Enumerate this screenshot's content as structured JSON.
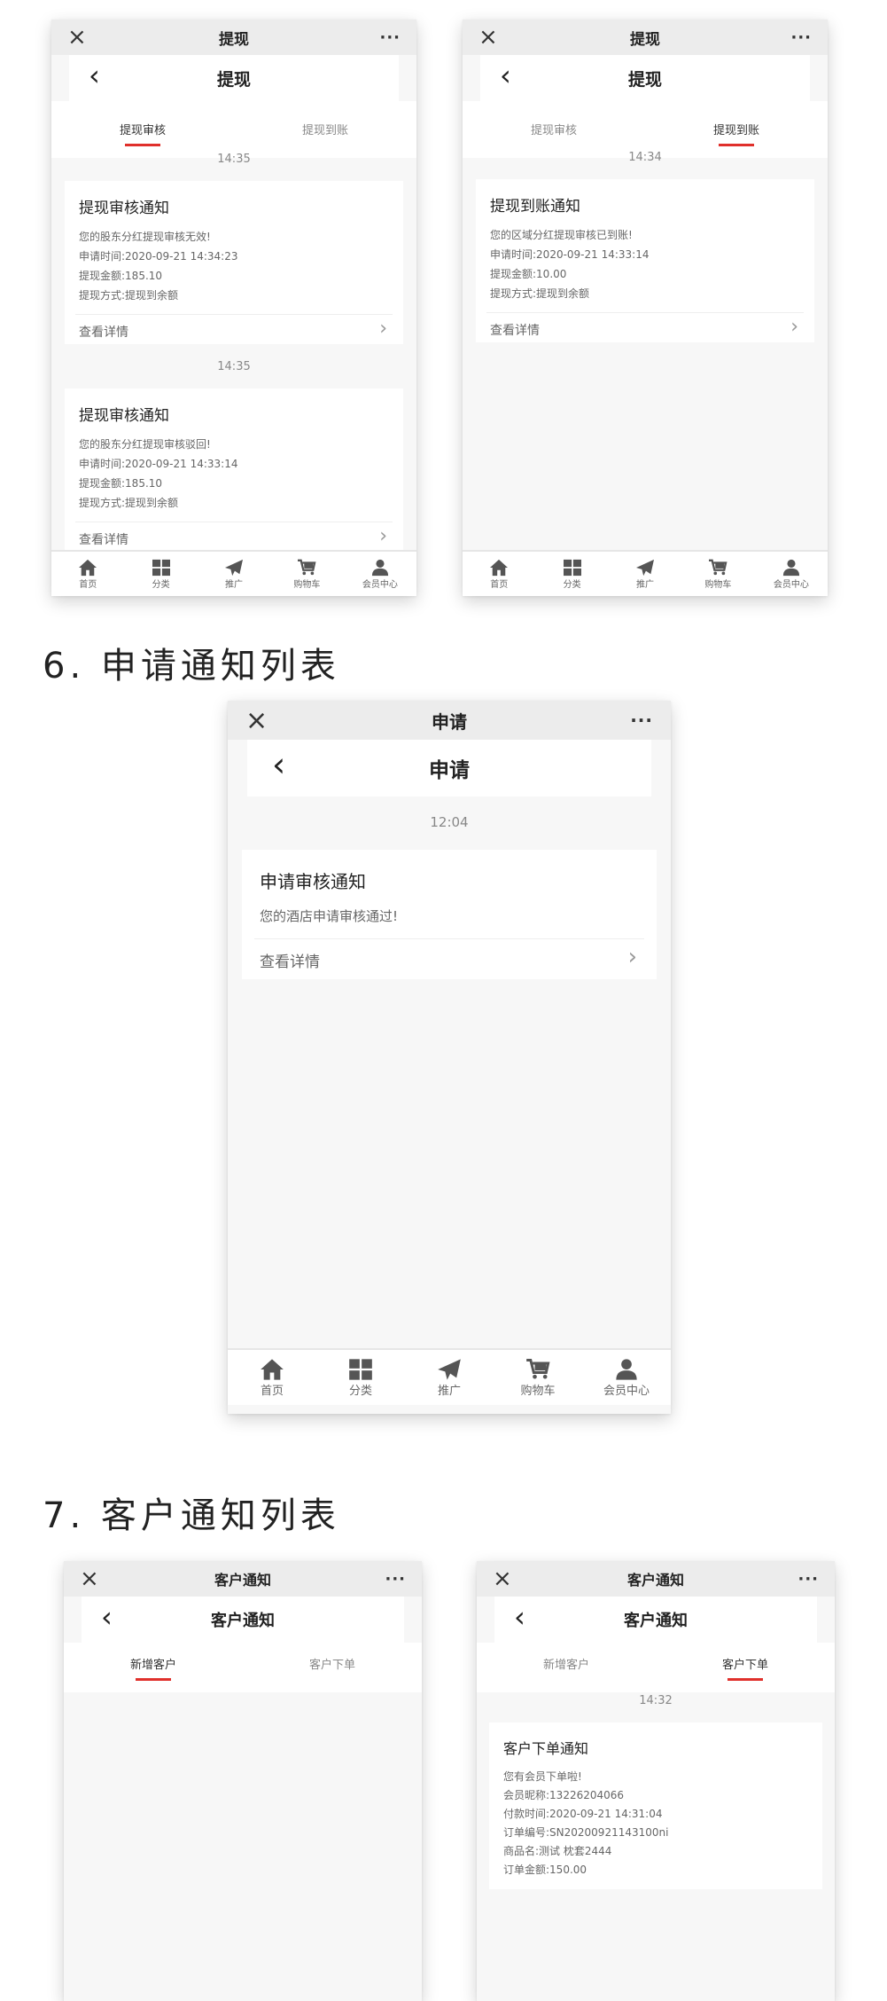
{
  "sections": {
    "s6": "6. 申请通知列表",
    "s7": "7. 客户通知列表"
  },
  "common": {
    "close_icon": "×",
    "more_icon": "···",
    "back_icon": "‹",
    "detail": "查看详情",
    "arrow": "›"
  },
  "nav": {
    "items": [
      {
        "icon": "home-icon",
        "label": "首页"
      },
      {
        "icon": "grid-icon",
        "label": "分类"
      },
      {
        "icon": "paper-plane-icon",
        "label": "推广"
      },
      {
        "icon": "cart-icon",
        "label": "购物车"
      },
      {
        "icon": "user-icon",
        "label": "会员中心"
      }
    ]
  },
  "withdraw_review": {
    "title": "提现",
    "tabs": [
      "提现审核",
      "提现到账"
    ],
    "active_tab": 0,
    "notices": [
      {
        "time": "14:35",
        "title": "提现审核通知",
        "lines": [
          "您的股东分红提现审核无效!",
          "申请时间:2020-09-21 14:34:23",
          "提现金额:185.10",
          "提现方式:提现到余额"
        ]
      },
      {
        "time": "14:35",
        "title": "提现审核通知",
        "lines": [
          "您的股东分红提现审核驳回!",
          "申请时间:2020-09-21 14:33:14",
          "提现金额:185.10",
          "提现方式:提现到余额"
        ]
      }
    ]
  },
  "withdraw_arrival": {
    "title": "提现",
    "tabs": [
      "提现审核",
      "提现到账"
    ],
    "active_tab": 1,
    "notices": [
      {
        "time": "14:34",
        "title": "提现到账通知",
        "lines": [
          "您的区域分红提现审核已到账!",
          "申请时间:2020-09-21 14:33:14",
          "提现金额:10.00",
          "提现方式:提现到余额"
        ]
      }
    ]
  },
  "apply": {
    "title": "申请",
    "notices": [
      {
        "time": "12:04",
        "title": "申请审核通知",
        "lines": [
          "您的酒店申请审核通过!"
        ]
      }
    ]
  },
  "customer_new": {
    "title": "客户通知",
    "tabs": [
      "新增客户",
      "客户下单"
    ],
    "active_tab": 0
  },
  "customer_order": {
    "title": "客户通知",
    "tabs": [
      "新增客户",
      "客户下单"
    ],
    "active_tab": 1,
    "notices": [
      {
        "time": "14:32",
        "title": "客户下单通知",
        "lines": [
          "您有会员下单啦!",
          "会员昵称:13226204066",
          "付款时间:2020-09-21 14:31:04",
          "订单编号:SN20200921143100ni",
          "商品名:测试 枕套2444",
          "订单金额:150.00"
        ]
      }
    ]
  }
}
